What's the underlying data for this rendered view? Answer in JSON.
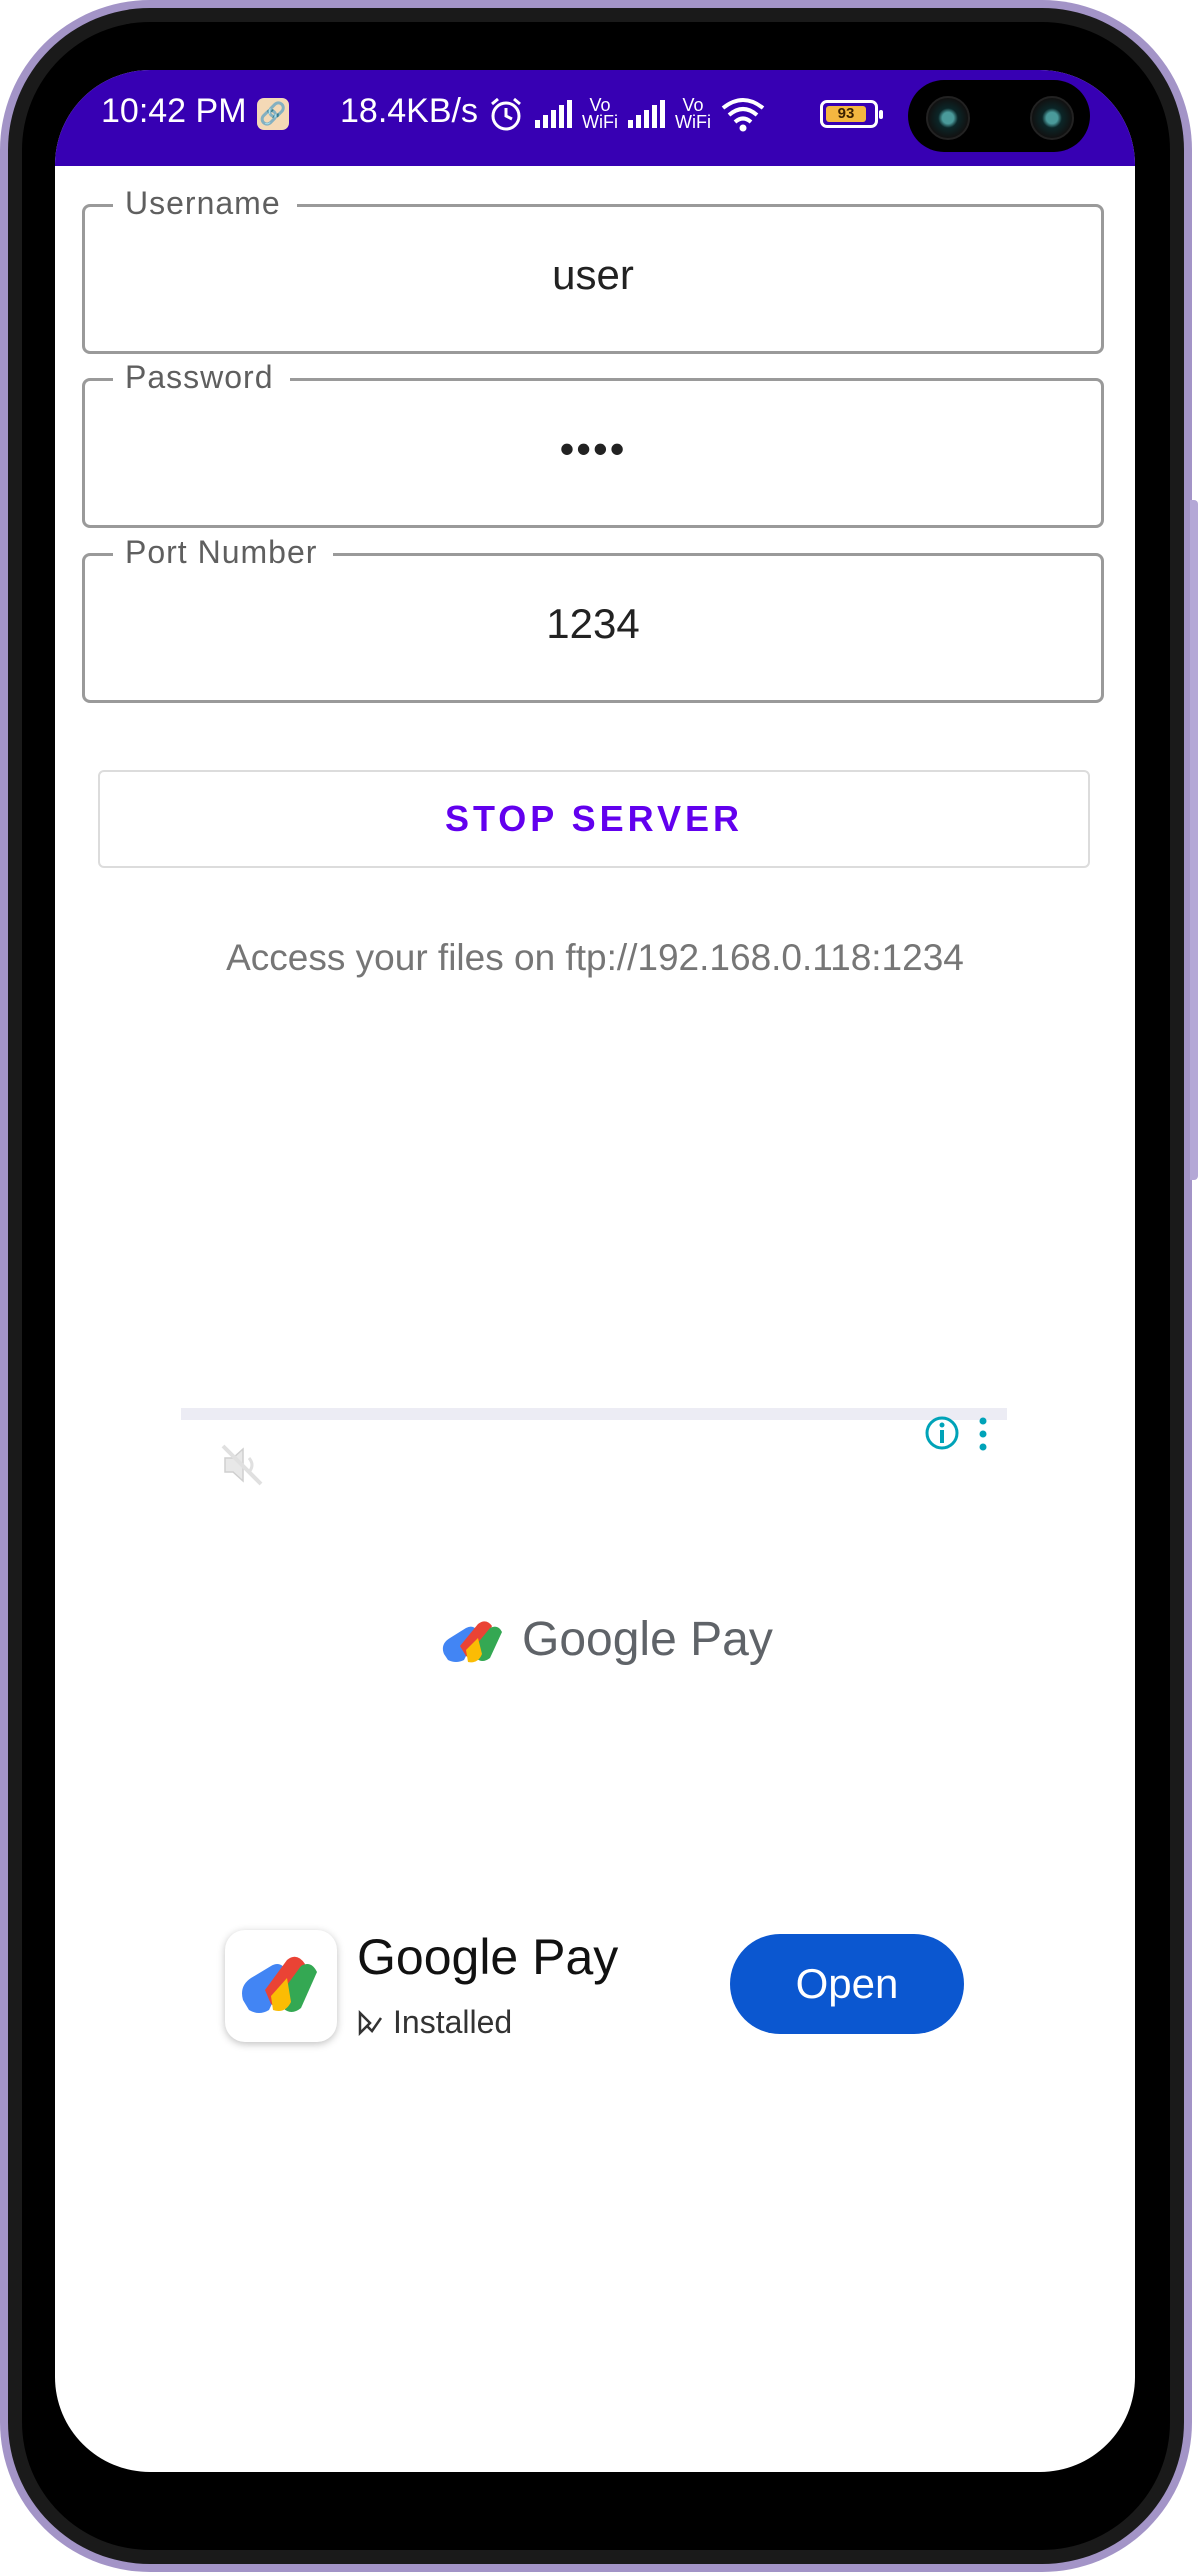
{
  "status_bar": {
    "time": "10:42 PM",
    "net_speed": "18.4KB/s",
    "vowifi_1_top": "Vo",
    "vowifi_1_bottom": "WiFi",
    "vowifi_2_top": "Vo",
    "vowifi_2_bottom": "WiFi",
    "battery_level": "93",
    "background_color": "#3700b3"
  },
  "form": {
    "username_label": "Username",
    "username_value": "user",
    "password_label": "Password",
    "password_value": "••••",
    "port_label": "Port Number",
    "port_value": "1234"
  },
  "stop_button_label": "STOP SERVER",
  "access_message": "Access your files on ftp://192.168.0.118:1234",
  "ad": {
    "brand_wordmark": "Google Pay",
    "app_name": "Google Pay",
    "app_status": "Installed",
    "open_button_label": "Open",
    "open_button_color": "#0b57d0"
  },
  "accent_color": "#6200ee"
}
